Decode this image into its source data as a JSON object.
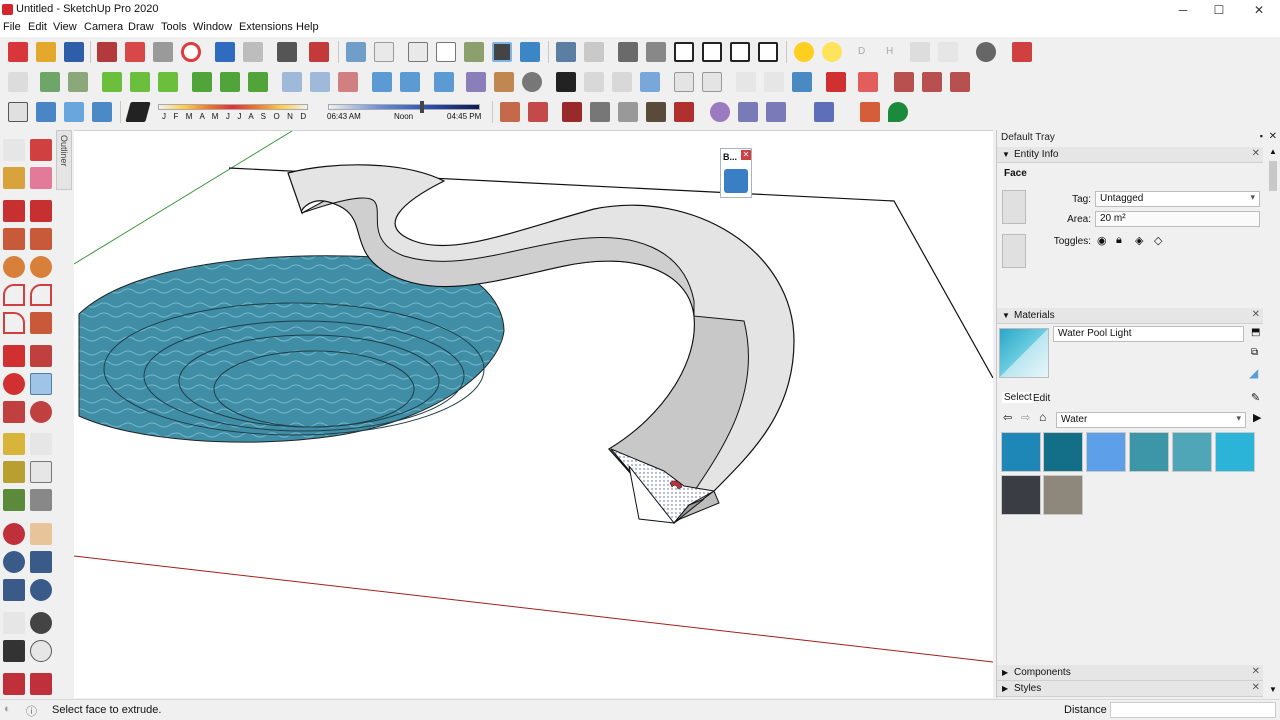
{
  "window": {
    "title": "Untitled - SketchUp Pro 2020",
    "minimize": "─",
    "maximize": "☐",
    "close": "✕"
  },
  "menu": [
    "File",
    "Edit",
    "View",
    "Camera",
    "Draw",
    "Tools",
    "Window",
    "Extensions",
    "Help"
  ],
  "shadows": {
    "months": "J  F  M  A  M  J  J  A  S  O  N  D",
    "time_start": "06:43 AM",
    "time_mid": "Noon",
    "time_end": "04:45 PM",
    "sun_letters": [
      "D",
      "H"
    ]
  },
  "outliner_tab": "Outliner",
  "float_panel": {
    "label": "B...",
    "close": "✕"
  },
  "tray": {
    "title": "Default Tray",
    "entity_info": {
      "header": "Entity Info",
      "entity_type": "Face",
      "tag_label": "Tag:",
      "tag_value": "Untagged",
      "area_label": "Area:",
      "area_value": "20 m²",
      "toggles_label": "Toggles:"
    },
    "materials": {
      "header": "Materials",
      "material_name": "Water Pool Light",
      "tab_select": "Select",
      "tab_edit": "Edit",
      "library": "Water",
      "swatch_colors": [
        "#1f86b8",
        "#126f87",
        "#5d9fe9",
        "#3d95a8",
        "#4fa6b6",
        "#2bb4d8",
        "#3b3d44",
        "#8e877c"
      ]
    },
    "components": "Components",
    "styles": "Styles"
  },
  "status": {
    "message": "Select face to extrude.",
    "measure_label": "Distance",
    "info_icon": "ⓘ"
  },
  "colors": {
    "water": "#3f8ea6",
    "accent": "#0078d7",
    "red_axis": "#a0201a",
    "green_axis": "#3a9a3a"
  }
}
